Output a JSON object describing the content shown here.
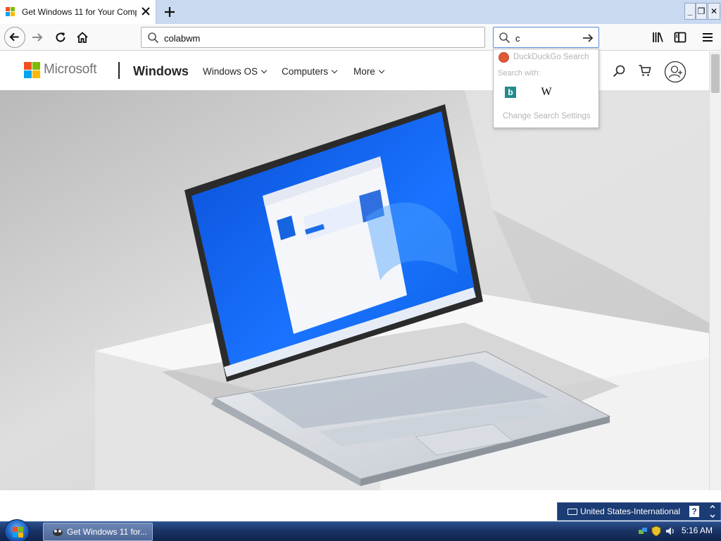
{
  "browser": {
    "tab_title": "Get Windows 11 for Your Comp",
    "new_tab_label": "+",
    "address_value": "colabwm",
    "search_value": "c",
    "window_controls": {
      "minimize": "_",
      "restore": "❐",
      "close": "✕"
    }
  },
  "search_popup": {
    "engine_label": "DuckDuckGo Search",
    "search_with_label": "Search with:",
    "bing_label": "b",
    "wiki_label": "W",
    "settings_label": "Change Search Settings"
  },
  "page_header": {
    "brand": "Microsoft",
    "product": "Windows",
    "nav": [
      "Windows OS",
      "Computers",
      "More"
    ]
  },
  "language_bar": {
    "language": "United States-International",
    "help_label": "?"
  },
  "taskbar": {
    "task_label": "Get Windows 11 for...",
    "clock": "5:16 AM"
  },
  "colors": {
    "ms_red": "#f25022",
    "ms_green": "#7fba00",
    "ms_blue": "#00a4ef",
    "ms_yellow": "#ffb900",
    "taskbar": "#1a3466",
    "langbar": "#1b3c74"
  },
  "icons": [
    "back-arrow-icon",
    "forward-arrow-icon",
    "reload-icon",
    "home-icon",
    "search-icon",
    "go-arrow-icon",
    "library-icon",
    "sidebar-icon",
    "hamburger-menu-icon",
    "cart-icon",
    "account-icon",
    "keyboard-icon",
    "shield-icon",
    "network-icon",
    "volume-icon"
  ]
}
